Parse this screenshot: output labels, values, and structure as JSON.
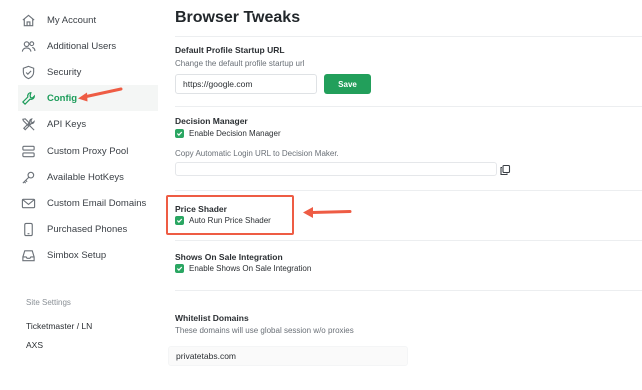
{
  "sidebar": {
    "items": [
      {
        "label": "My Account",
        "icon": "home-icon"
      },
      {
        "label": "Additional Users",
        "icon": "users-icon"
      },
      {
        "label": "Security",
        "icon": "shield-icon"
      },
      {
        "label": "Config",
        "icon": "wrench-icon",
        "active": true
      },
      {
        "label": "API Keys",
        "icon": "tools-icon"
      },
      {
        "label": "Custom Proxy Pool",
        "icon": "database-icon"
      },
      {
        "label": "Available HotKeys",
        "icon": "key-icon"
      },
      {
        "label": "Custom Email Domains",
        "icon": "envelope-icon"
      },
      {
        "label": "Purchased Phones",
        "icon": "phone-icon"
      },
      {
        "label": "Simbox Setup",
        "icon": "inbox-icon"
      }
    ],
    "site_settings_label": "Site Settings",
    "site_links": [
      "Ticketmaster / LN",
      "AXS"
    ]
  },
  "main": {
    "title": "Browser Tweaks",
    "startup": {
      "title": "Default Profile Startup URL",
      "subtitle": "Change the default profile startup url",
      "value": "https://google.com",
      "save_label": "Save"
    },
    "decision": {
      "title": "Decision Manager",
      "checkbox_label": "Enable Decision Manager",
      "checked": true,
      "copy_label": "Copy Automatic Login URL to Decision Maker.",
      "url_value": ""
    },
    "price_shader": {
      "title": "Price Shader",
      "checkbox_label": "Auto Run Price Shader",
      "checked": true
    },
    "shows_on_sale": {
      "title": "Shows On Sale Integration",
      "checkbox_label": "Enable Shows On Sale Integration",
      "checked": true
    },
    "whitelist": {
      "title": "Whitelist Domains",
      "subtitle": "These domains will use global session w/o proxies",
      "value": "privatetabs.com"
    }
  },
  "colors": {
    "accent_green": "#229f5b",
    "annotation_red": "#ee5c44"
  }
}
